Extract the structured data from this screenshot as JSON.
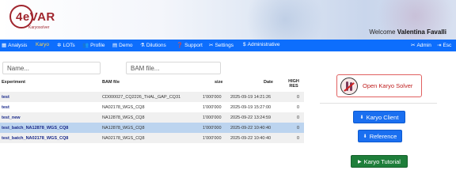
{
  "header": {
    "logo_text": "4eVAR",
    "logo_subtitle": "Karyosolver",
    "welcome_prefix": "Welcome",
    "user_name": "Valentina Favalli"
  },
  "nav": {
    "items": [
      {
        "label": "Analysis",
        "icon": "table-icon"
      },
      {
        "label": "Karyo",
        "icon": "none"
      },
      {
        "label": "LOTs",
        "icon": "bug-icon"
      },
      {
        "label": "Profile",
        "icon": "users-icon"
      },
      {
        "label": "Demo",
        "icon": "film-icon"
      },
      {
        "label": "Dilutions",
        "icon": "flask-icon"
      },
      {
        "label": "Support",
        "icon": "question-icon"
      },
      {
        "label": "Settings",
        "icon": "wrench-icon"
      },
      {
        "label": "Administrative",
        "icon": "dollar-icon"
      }
    ],
    "active": "Karyo",
    "right_items": [
      {
        "label": "Admin",
        "icon": "wrench-icon"
      },
      {
        "label": "Esc",
        "icon": "logout-icon"
      }
    ]
  },
  "search": {
    "name_placeholder": "Name...",
    "bam_placeholder": "BAM file..."
  },
  "table": {
    "headers": {
      "experiment": "Experiment",
      "bam": "BAM file",
      "size": "size",
      "date": "Date",
      "high_res": "HIGH RES"
    },
    "rows": [
      {
        "experiment": "test",
        "bam": "CD000027_CQ2226_THAL_GAP_CQ31",
        "size": "1'000'000",
        "date": "2025-09-19 14:21:26",
        "high_res": "0"
      },
      {
        "experiment": "test",
        "bam": "NA02178_WGS_CQ8",
        "size": "1'000'000",
        "date": "2025-09-19 15:27:00",
        "high_res": "0"
      },
      {
        "experiment": "test_new",
        "bam": "NA12878_WGS_CQ8",
        "size": "1'000'000",
        "date": "2025-09-22 13:24:59",
        "high_res": "0"
      },
      {
        "experiment": "test_batch_NA12878_WGS_CQ8",
        "bam": "NA12878_WGS_CQ8",
        "size": "1'000'000",
        "date": "2025-09-22 10:40:40",
        "high_res": "0"
      },
      {
        "experiment": "test_batch_NA02178_WGS_CQ8",
        "bam": "NA02178_WGS_CQ8",
        "size": "1'000'000",
        "date": "2025-09-22 10:40:40",
        "high_res": "0"
      }
    ],
    "selected_row": 3
  },
  "panel": {
    "solver_label": "Open Karyo Solver",
    "client_label": "Karyo Client",
    "reference_label": "Reference",
    "tutorial_label": "Karyo Tutorial"
  },
  "colors": {
    "navbar": "#0d6efd",
    "active_nav": "#ffd44d",
    "brand": "#a0262e",
    "primary_button": "#1a6ff0",
    "success_button": "#1e7e3a",
    "selected_row": "#bcd4ef"
  }
}
